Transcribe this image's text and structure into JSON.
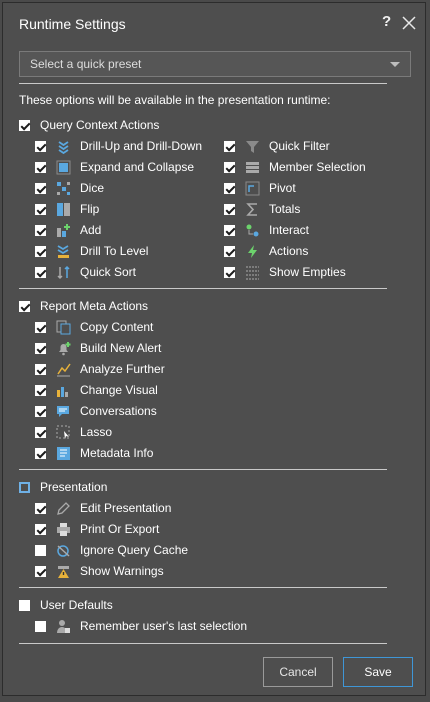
{
  "dialog": {
    "title": "Runtime Settings",
    "help": "?",
    "preset_placeholder": "Select a quick preset",
    "intro": "These options will be available in the presentation runtime:"
  },
  "groups": {
    "query": {
      "label": "Query Context Actions",
      "state": "checked",
      "left": [
        {
          "label": "Drill-Up and Drill-Down",
          "checked": true,
          "icon": "drill-up-down-icon"
        },
        {
          "label": "Expand and Collapse",
          "checked": true,
          "icon": "expand-collapse-icon"
        },
        {
          "label": "Dice",
          "checked": true,
          "icon": "dice-icon"
        },
        {
          "label": "Flip",
          "checked": true,
          "icon": "flip-icon"
        },
        {
          "label": "Add",
          "checked": true,
          "icon": "add-icon"
        },
        {
          "label": "Drill To Level",
          "checked": true,
          "icon": "drill-to-level-icon"
        },
        {
          "label": "Quick Sort",
          "checked": true,
          "icon": "quick-sort-icon"
        }
      ],
      "right": [
        {
          "label": "Quick Filter",
          "checked": true,
          "icon": "filter-icon"
        },
        {
          "label": "Member Selection",
          "checked": true,
          "icon": "member-selection-icon"
        },
        {
          "label": "Pivot",
          "checked": true,
          "icon": "pivot-icon"
        },
        {
          "label": "Totals",
          "checked": true,
          "icon": "sigma-icon"
        },
        {
          "label": "Interact",
          "checked": true,
          "icon": "interact-icon"
        },
        {
          "label": "Actions",
          "checked": true,
          "icon": "lightning-icon"
        },
        {
          "label": "Show Empties",
          "checked": true,
          "icon": "show-empties-icon"
        }
      ]
    },
    "report": {
      "label": "Report Meta Actions",
      "state": "checked",
      "items": [
        {
          "label": "Copy Content",
          "checked": true,
          "icon": "copy-icon"
        },
        {
          "label": "Build New Alert",
          "checked": true,
          "icon": "alert-bell-icon"
        },
        {
          "label": "Analyze Further",
          "checked": true,
          "icon": "analyze-icon"
        },
        {
          "label": "Change Visual",
          "checked": true,
          "icon": "change-visual-icon"
        },
        {
          "label": "Conversations",
          "checked": true,
          "icon": "conversation-icon"
        },
        {
          "label": "Lasso",
          "checked": true,
          "icon": "lasso-icon"
        },
        {
          "label": "Metadata Info",
          "checked": true,
          "icon": "metadata-icon"
        }
      ]
    },
    "presentation": {
      "label": "Presentation",
      "state": "partial",
      "items": [
        {
          "label": "Edit Presentation",
          "checked": true,
          "icon": "pencil-icon"
        },
        {
          "label": "Print Or Export",
          "checked": true,
          "icon": "printer-icon"
        },
        {
          "label": "Ignore Query Cache",
          "checked": false,
          "icon": "ignore-cache-icon"
        },
        {
          "label": "Show Warnings",
          "checked": true,
          "icon": "warning-icon"
        }
      ]
    },
    "user": {
      "label": "User Defaults",
      "state": "unchecked",
      "items": [
        {
          "label": "Remember user's last selection",
          "checked": false,
          "icon": "remember-user-icon"
        }
      ]
    }
  },
  "buttons": {
    "cancel": "Cancel",
    "save": "Save"
  },
  "colors": {
    "accent": "#3f96d6",
    "background": "#4e4e4e"
  }
}
